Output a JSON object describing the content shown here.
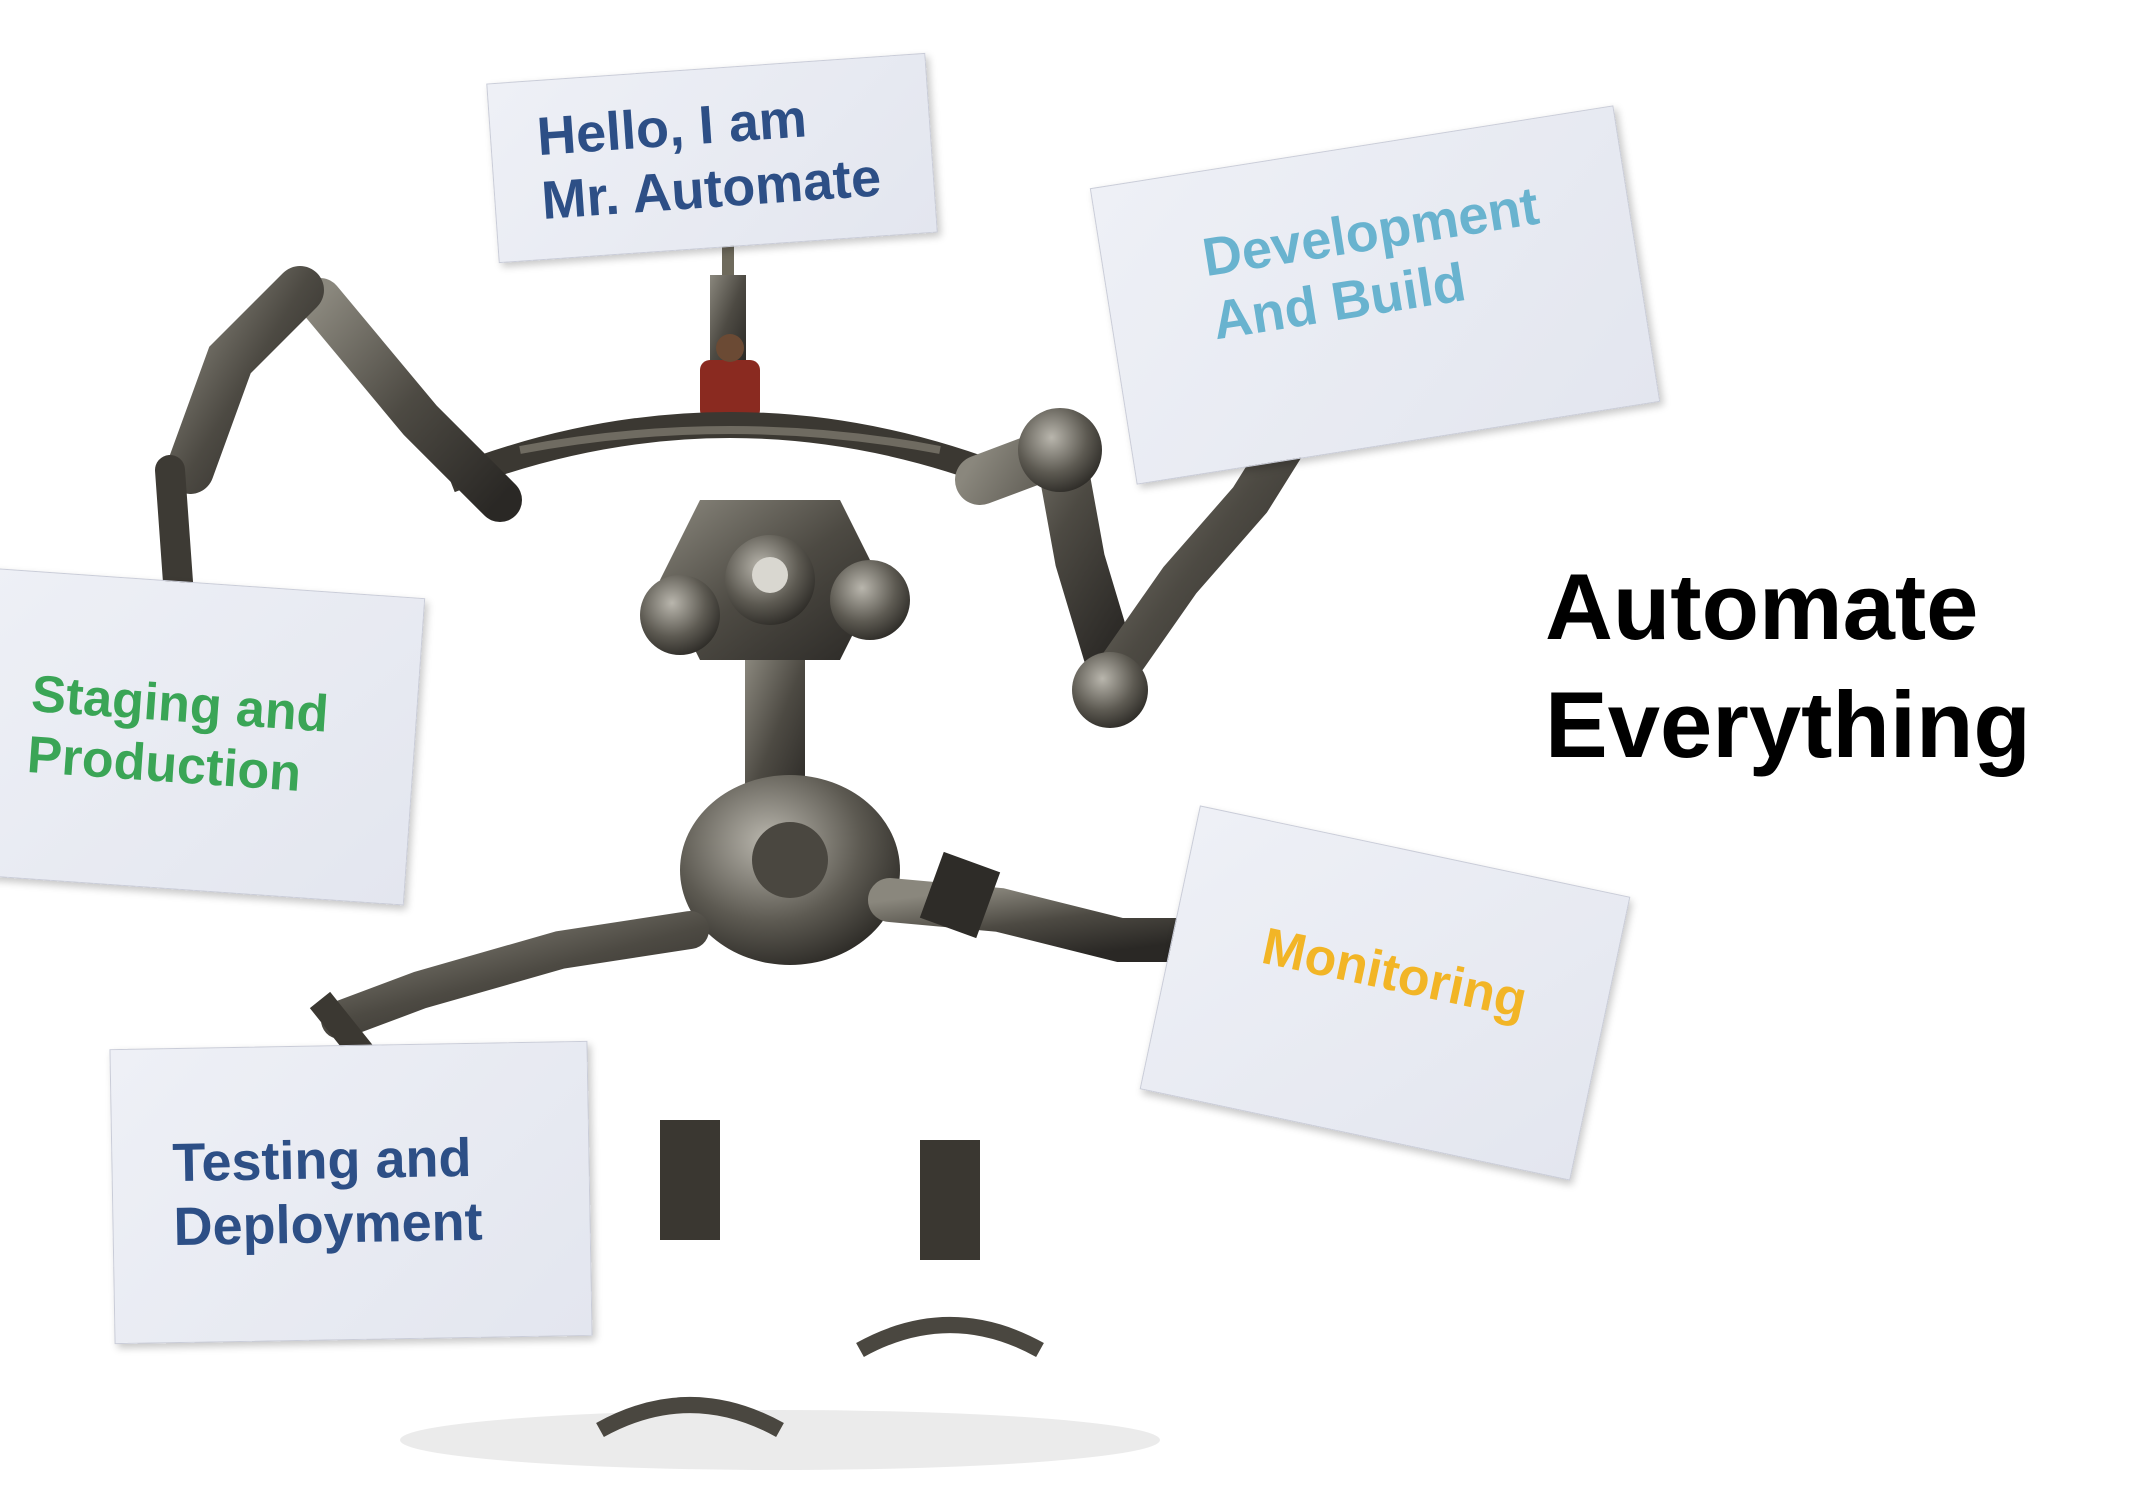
{
  "colors": {
    "hello": "#2d4f86",
    "dev": "#69b3cf",
    "staging": "#3aa556",
    "monitoring": "#f2b526",
    "testing": "#2d4f86",
    "headline": "#000000"
  },
  "cards": {
    "hello": {
      "line1": "Hello, I am",
      "line2": "Mr. Automate"
    },
    "dev": {
      "line1": "Development",
      "line2": "And Build"
    },
    "staging": {
      "line1": "Staging and",
      "line2": "Production"
    },
    "monitoring": {
      "line1": "Monitoring"
    },
    "testing": {
      "line1": "Testing and",
      "line2": "Deployment"
    }
  },
  "headline": {
    "line1": "Automate",
    "line2": "Everything"
  }
}
